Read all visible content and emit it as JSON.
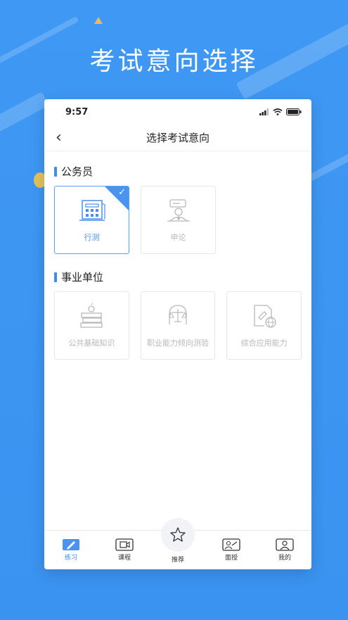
{
  "hero": {
    "title": "考试意向选择"
  },
  "status_bar": {
    "time": "9:57"
  },
  "nav": {
    "title": "选择考试意向"
  },
  "sections": [
    {
      "title": "公务员",
      "cards": [
        {
          "label": "行测",
          "icon": "building-icon",
          "selected": true
        },
        {
          "label": "申论",
          "icon": "speaker-icon",
          "selected": false
        }
      ]
    },
    {
      "title": "事业单位",
      "cards": [
        {
          "label": "公共基础知识",
          "icon": "books-icon",
          "selected": false
        },
        {
          "label": "职业能力倾向测验",
          "icon": "brain-balance-icon",
          "selected": false
        },
        {
          "label": "综合应用能力",
          "icon": "document-globe-icon",
          "selected": false
        }
      ]
    }
  ],
  "tabs": [
    {
      "label": "练习",
      "icon": "pencil-icon",
      "active": true
    },
    {
      "label": "课程",
      "icon": "video-icon",
      "active": false
    },
    {
      "label": "推荐",
      "icon": "star-icon",
      "active": false
    },
    {
      "label": "面授",
      "icon": "teacher-board-icon",
      "active": false
    },
    {
      "label": "我的",
      "icon": "user-icon",
      "active": false
    }
  ],
  "colors": {
    "background": "#3f98f3",
    "accent": "#3b8ef0",
    "muted": "#b8b8b8"
  }
}
